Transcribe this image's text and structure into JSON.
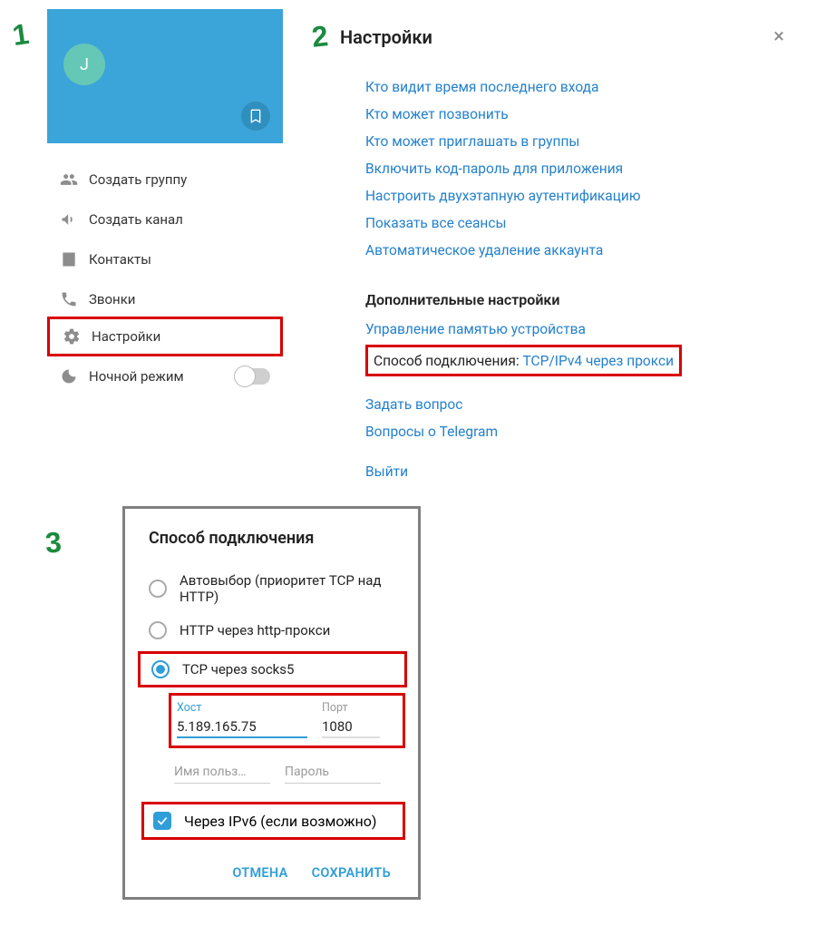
{
  "steps": {
    "one": "1",
    "two": "2",
    "three": "3"
  },
  "sidebar": {
    "avatar_letter": "J",
    "items": {
      "new_group": "Создать группу",
      "new_channel": "Создать канал",
      "contacts": "Контакты",
      "calls": "Звонки",
      "settings": "Настройки",
      "night_mode": "Ночной режим"
    }
  },
  "settings": {
    "title": "Настройки",
    "links": {
      "last_seen": "Кто видит время последнего входа",
      "who_can_call": "Кто может позвонить",
      "who_can_invite": "Кто может приглашать в группы",
      "enable_passcode": "Включить код-пароль для приложения",
      "two_step": "Настроить двухэтапную аутентификацию",
      "all_sessions": "Показать все сеансы",
      "auto_delete": "Автоматическое удаление аккаунта"
    },
    "section_advanced": "Дополнительные настройки",
    "advanced": {
      "storage": "Управление памятью устройства",
      "connection_label": "Способ подключения: ",
      "connection_value": "TCP/IPv4 через прокси",
      "ask_question": "Задать вопрос",
      "telegram_faq": "Вопросы о Telegram",
      "logout": "Выйти"
    }
  },
  "dialog": {
    "title": "Способ подключения",
    "opt_auto": "Автовыбор (приоритет TCP над HTTP)",
    "opt_http": "HTTP через http-прокси",
    "opt_socks5": "TCP через socks5",
    "host_label": "Хост",
    "host_value": "5.189.165.75",
    "port_label": "Порт",
    "port_value": "1080",
    "username_ph": "Имя польз…",
    "password_ph": "Пароль",
    "ipv6": "Через IPv6 (если возможно)",
    "cancel": "ОТМЕНА",
    "save": "СОХРАНИТЬ"
  }
}
